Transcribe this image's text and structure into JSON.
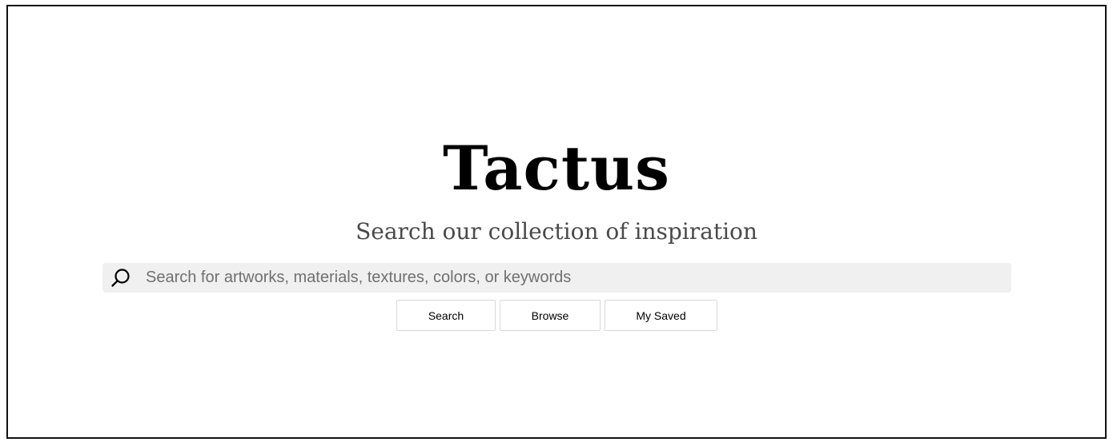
{
  "page": {
    "title": "Tactus",
    "subtitle": "Search our collection of inspiration"
  },
  "search": {
    "icon": "search-icon",
    "placeholder": "Search for artworks, materials, textures, colors, or keywords",
    "value": ""
  },
  "actions": {
    "search_label": "Search",
    "browse_label": "Browse",
    "saved_label": "My Saved"
  },
  "colors": {
    "background": "#ffffff",
    "frame_border": "#111111",
    "search_bar_bg": "#f0f0f0",
    "subtitle_text": "#4a4a4a",
    "placeholder_text": "#707070",
    "button_border": "#d8d8d8"
  }
}
